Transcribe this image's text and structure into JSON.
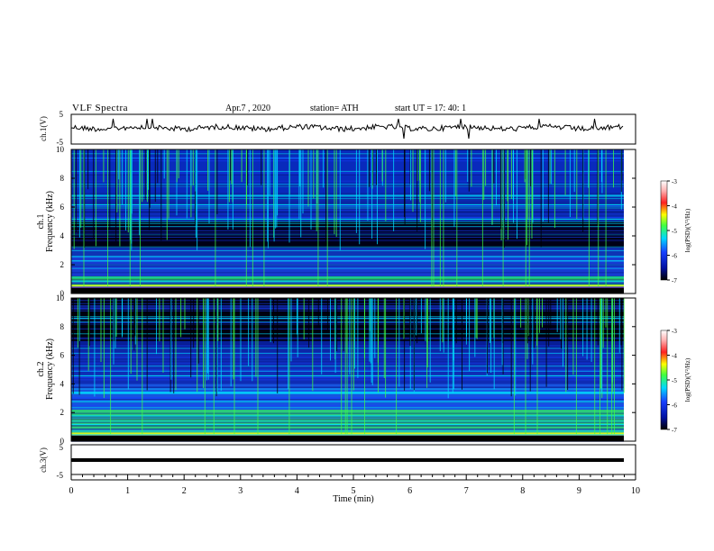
{
  "header": {
    "title": "VLF  Spectra",
    "date": "Apr.7  , 2020",
    "station": "station= ATH",
    "start_ut": "start  UT  =   17: 40: 1"
  },
  "colors": {
    "background": "#000000",
    "deep_blue": "#0a1a8c",
    "blue": "#1840ff",
    "cyan": "#00e0ff",
    "green": "#40ff40",
    "yellow": "#ffff00",
    "red": "#ff2020"
  },
  "chart_data": [
    {
      "type": "line",
      "ylabel": "ch.1(V)",
      "ylim": [
        -5,
        5
      ],
      "y_ticks": [
        "5",
        "-5"
      ],
      "note": "waveform near 0 V with occasional spikes"
    },
    {
      "type": "heatmap",
      "ylabel": "ch.1\nFrequency  (kHz)",
      "ylim": [
        0,
        10
      ],
      "y_ticks": [
        "0",
        "2",
        "4",
        "6",
        "8",
        "10"
      ],
      "colorbar": {
        "label": "log(PSD)(V²/Hz)",
        "ticks": [
          "-3",
          "-4",
          "-5",
          "-6",
          "-7"
        ],
        "range": [
          -7,
          -3
        ]
      }
    },
    {
      "type": "heatmap",
      "ylabel": "ch.2\nFrequency  (kHz)",
      "ylim": [
        0,
        10
      ],
      "y_ticks": [
        "0",
        "2",
        "4",
        "6",
        "8",
        "10"
      ],
      "colorbar": {
        "label": "log(PSD)(V²/Hz)",
        "ticks": [
          "-3",
          "-4",
          "-5",
          "-6",
          "-7"
        ],
        "range": [
          -7,
          -3
        ]
      }
    },
    {
      "type": "line",
      "ylabel": "ch.3(V)",
      "ylim": [
        -5,
        5
      ],
      "y_ticks": [
        "5",
        "-5"
      ],
      "note": "flat trace near -1.5 V"
    }
  ],
  "x_axis": {
    "label": "Time  (min)",
    "ticks": [
      "0",
      "1",
      "2",
      "3",
      "4",
      "5",
      "6",
      "7",
      "8",
      "9",
      "10"
    ],
    "range": [
      0,
      10
    ]
  }
}
